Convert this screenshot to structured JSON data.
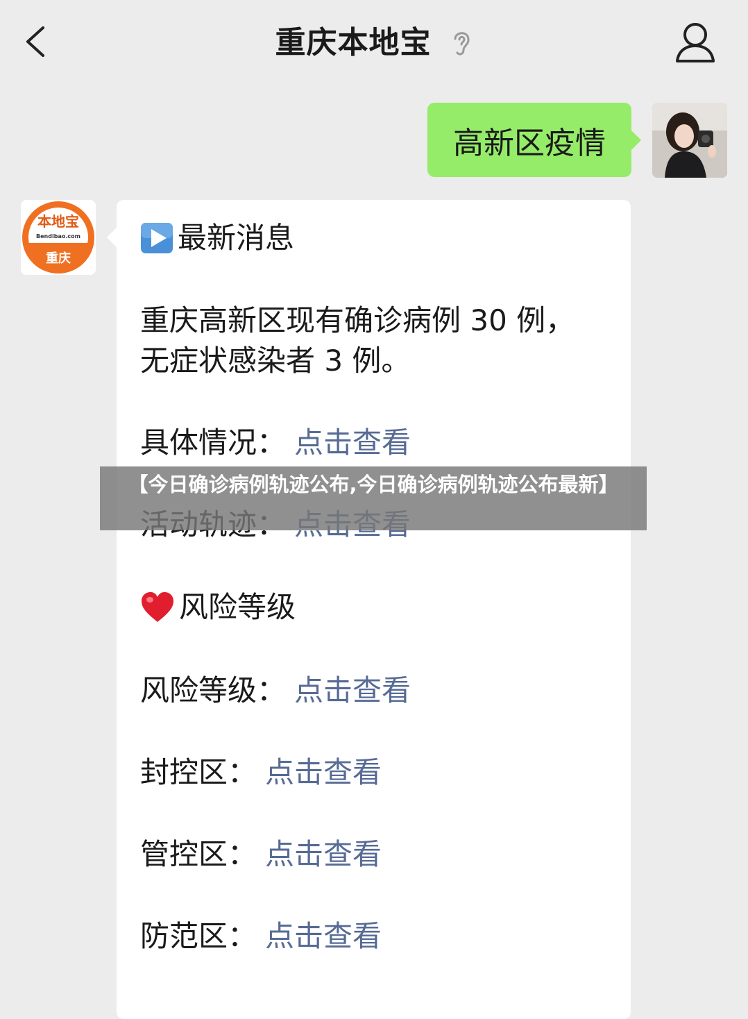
{
  "header": {
    "title": "重庆本地宝"
  },
  "outgoing": {
    "text": "高新区疫情"
  },
  "bot": {
    "logo_main": "本地宝",
    "logo_domain": "Bendibao.com",
    "logo_city": "重庆"
  },
  "message": {
    "latest_title": "最新消息",
    "summary_line1": "重庆高新区现有确诊病例 30 例，",
    "summary_line2": "无症状感染者 3 例。",
    "details_label": "具体情况：",
    "details_link": "点击查看",
    "activity_label": "活动轨迹：",
    "activity_link": "点击查看",
    "risk_title": "风险等级",
    "risk_label": "风险等级：",
    "risk_link": "点击查看",
    "sealed_label": "封控区：",
    "sealed_link": "点击查看",
    "controlled_label": "管控区：",
    "controlled_link": "点击查看",
    "prevention_label": "防范区：",
    "prevention_link": "点击查看"
  },
  "banner": {
    "text": "【今日确诊病例轨迹公布,今日确诊病例轨迹公布最新】"
  },
  "colors": {
    "background": "#ececec",
    "outgoing_bubble": "#95ec69",
    "link": "#576b95",
    "logo_orange": "#f07022"
  }
}
